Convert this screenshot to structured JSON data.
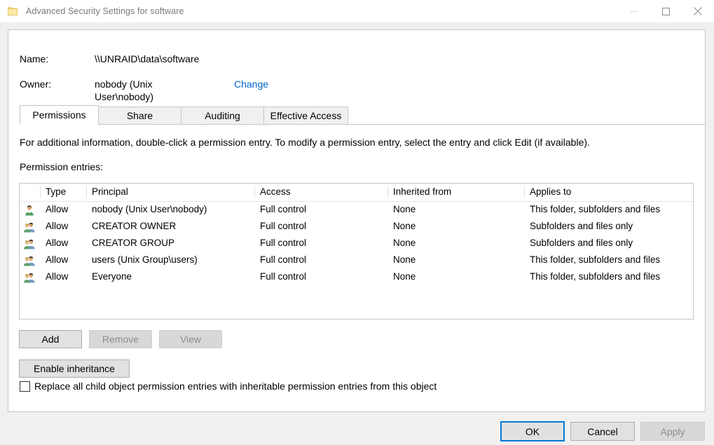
{
  "window": {
    "title": "Advanced Security Settings for software",
    "icon": "folder-icon",
    "controls": {
      "minimize": "minimize-icon",
      "maximize": "maximize-icon",
      "close": "close-icon"
    }
  },
  "header": {
    "name_label": "Name:",
    "name_value": "\\\\UNRAID\\data\\software",
    "owner_label": "Owner:",
    "owner_value": "nobody (Unix User\\nobody)",
    "owner_change_link": "Change"
  },
  "tabs": [
    {
      "label": "Permissions",
      "active": true
    },
    {
      "label": "Share",
      "active": false
    },
    {
      "label": "Auditing",
      "active": false
    },
    {
      "label": "Effective Access",
      "active": false
    }
  ],
  "main": {
    "info_text": "For additional information, double-click a permission entry. To modify a permission entry, select the entry and click Edit (if available).",
    "entries_label": "Permission entries:",
    "columns": [
      "Type",
      "Principal",
      "Access",
      "Inherited from",
      "Applies to"
    ],
    "rows": [
      {
        "icon": "user-icon",
        "type": "Allow",
        "principal": "nobody (Unix User\\nobody)",
        "access": "Full control",
        "inherited_from": "None",
        "applies_to": "This folder, subfolders and files"
      },
      {
        "icon": "group-icon",
        "type": "Allow",
        "principal": "CREATOR OWNER",
        "access": "Full control",
        "inherited_from": "None",
        "applies_to": "Subfolders and files only"
      },
      {
        "icon": "group-icon",
        "type": "Allow",
        "principal": "CREATOR GROUP",
        "access": "Full control",
        "inherited_from": "None",
        "applies_to": "Subfolders and files only"
      },
      {
        "icon": "group-icon",
        "type": "Allow",
        "principal": "users (Unix Group\\users)",
        "access": "Full control",
        "inherited_from": "None",
        "applies_to": "This folder, subfolders and files"
      },
      {
        "icon": "group-icon",
        "type": "Allow",
        "principal": "Everyone",
        "access": "Full control",
        "inherited_from": "None",
        "applies_to": "This folder, subfolders and files"
      }
    ],
    "buttons": {
      "add": "Add",
      "remove": "Remove",
      "view": "View",
      "enable_inheritance": "Enable inheritance"
    },
    "replace_checkbox": {
      "label": "Replace all child object permission entries with inheritable permission entries from this object",
      "checked": false
    }
  },
  "footer": {
    "ok": "OK",
    "cancel": "Cancel",
    "apply": "Apply"
  },
  "colors": {
    "accent": "#0078d7",
    "link": "#0066cc",
    "panel_border": "#c6c6c6",
    "dialog_bg": "#f0f0f0"
  }
}
